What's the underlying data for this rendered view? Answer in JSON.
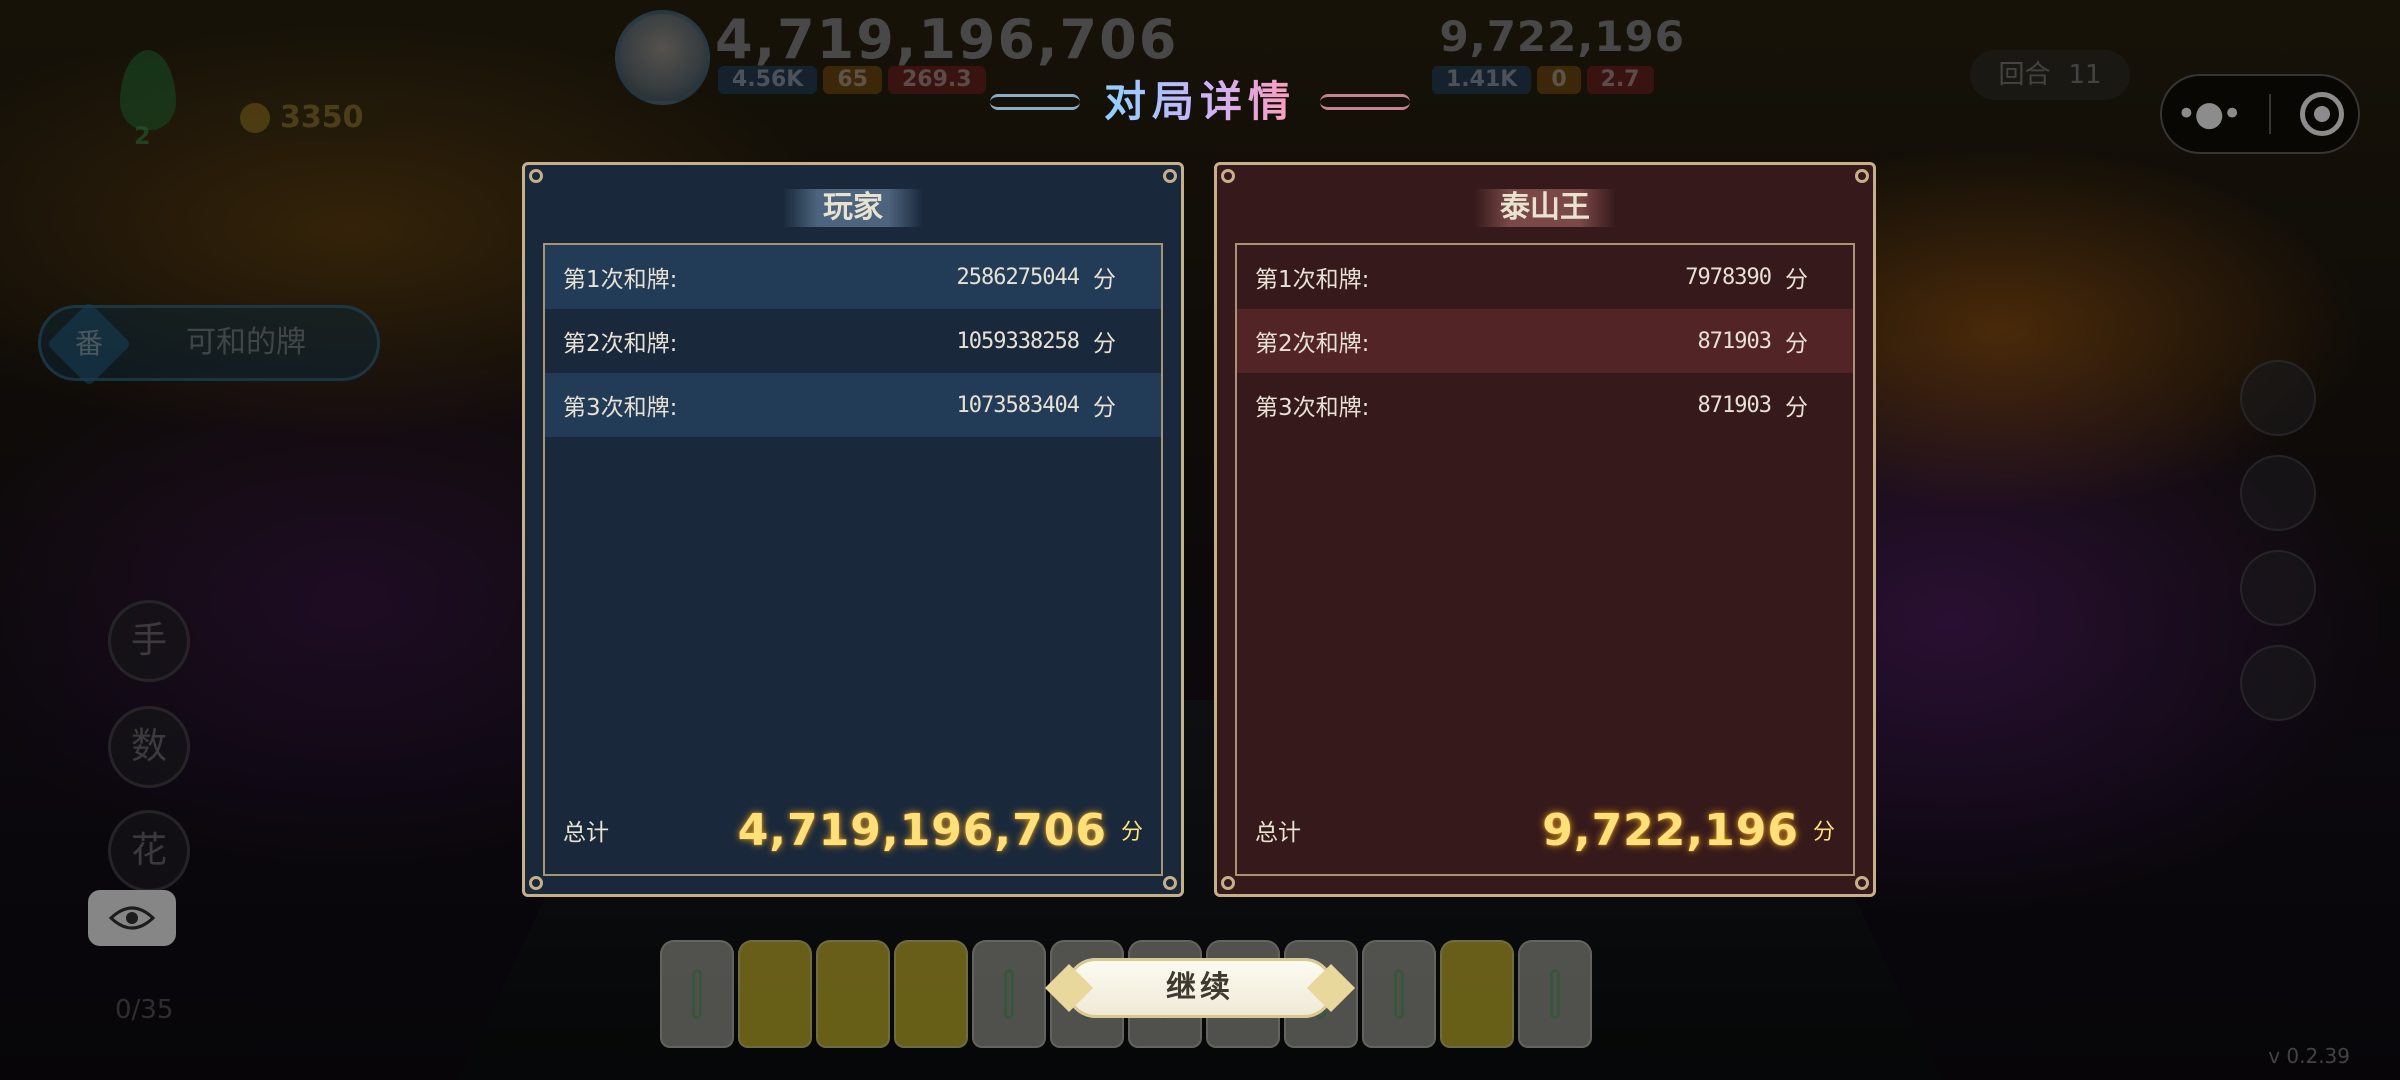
{
  "hud": {
    "player_score": "4,719,196,706",
    "player_stats": [
      "4.56K",
      "65",
      "269.3"
    ],
    "opponent_score": "9,722,196",
    "opponent_stats": [
      "1.41K",
      "0",
      "2.7"
    ],
    "round_label": "回合",
    "round_value": "11",
    "coins": "3350",
    "flame_value": "2"
  },
  "title": "对局详情",
  "player_panel": {
    "name": "玩家",
    "rows": [
      {
        "label": "第1次和牌:",
        "value": "2586275044",
        "unit": "分"
      },
      {
        "label": "第2次和牌:",
        "value": "1059338258",
        "unit": "分"
      },
      {
        "label": "第3次和牌:",
        "value": "1073583404",
        "unit": "分"
      }
    ],
    "total_label": "总计",
    "total_value": "4,719,196,706",
    "total_unit": "分"
  },
  "boss_panel": {
    "name": "泰山王",
    "rows": [
      {
        "label": "第1次和牌:",
        "value": "7978390",
        "unit": "分"
      },
      {
        "label": "第2次和牌:",
        "value": "871903",
        "unit": "分"
      },
      {
        "label": "第3次和牌:",
        "value": "871903",
        "unit": "分"
      }
    ],
    "total_label": "总计",
    "total_value": "9,722,196",
    "total_unit": "分"
  },
  "left_panel": {
    "winning_tiles_label": "可和的牌",
    "fan_glyph": "番",
    "buttons": [
      "手",
      "数",
      "花"
    ],
    "counter": "0/35"
  },
  "continue_label": "继续",
  "version": "v 0.2.39",
  "icons": {
    "more": "more-dots-icon",
    "close": "target-circle-icon",
    "eye": "eye-icon",
    "coin": "coin-icon",
    "flame": "flame-icon"
  }
}
